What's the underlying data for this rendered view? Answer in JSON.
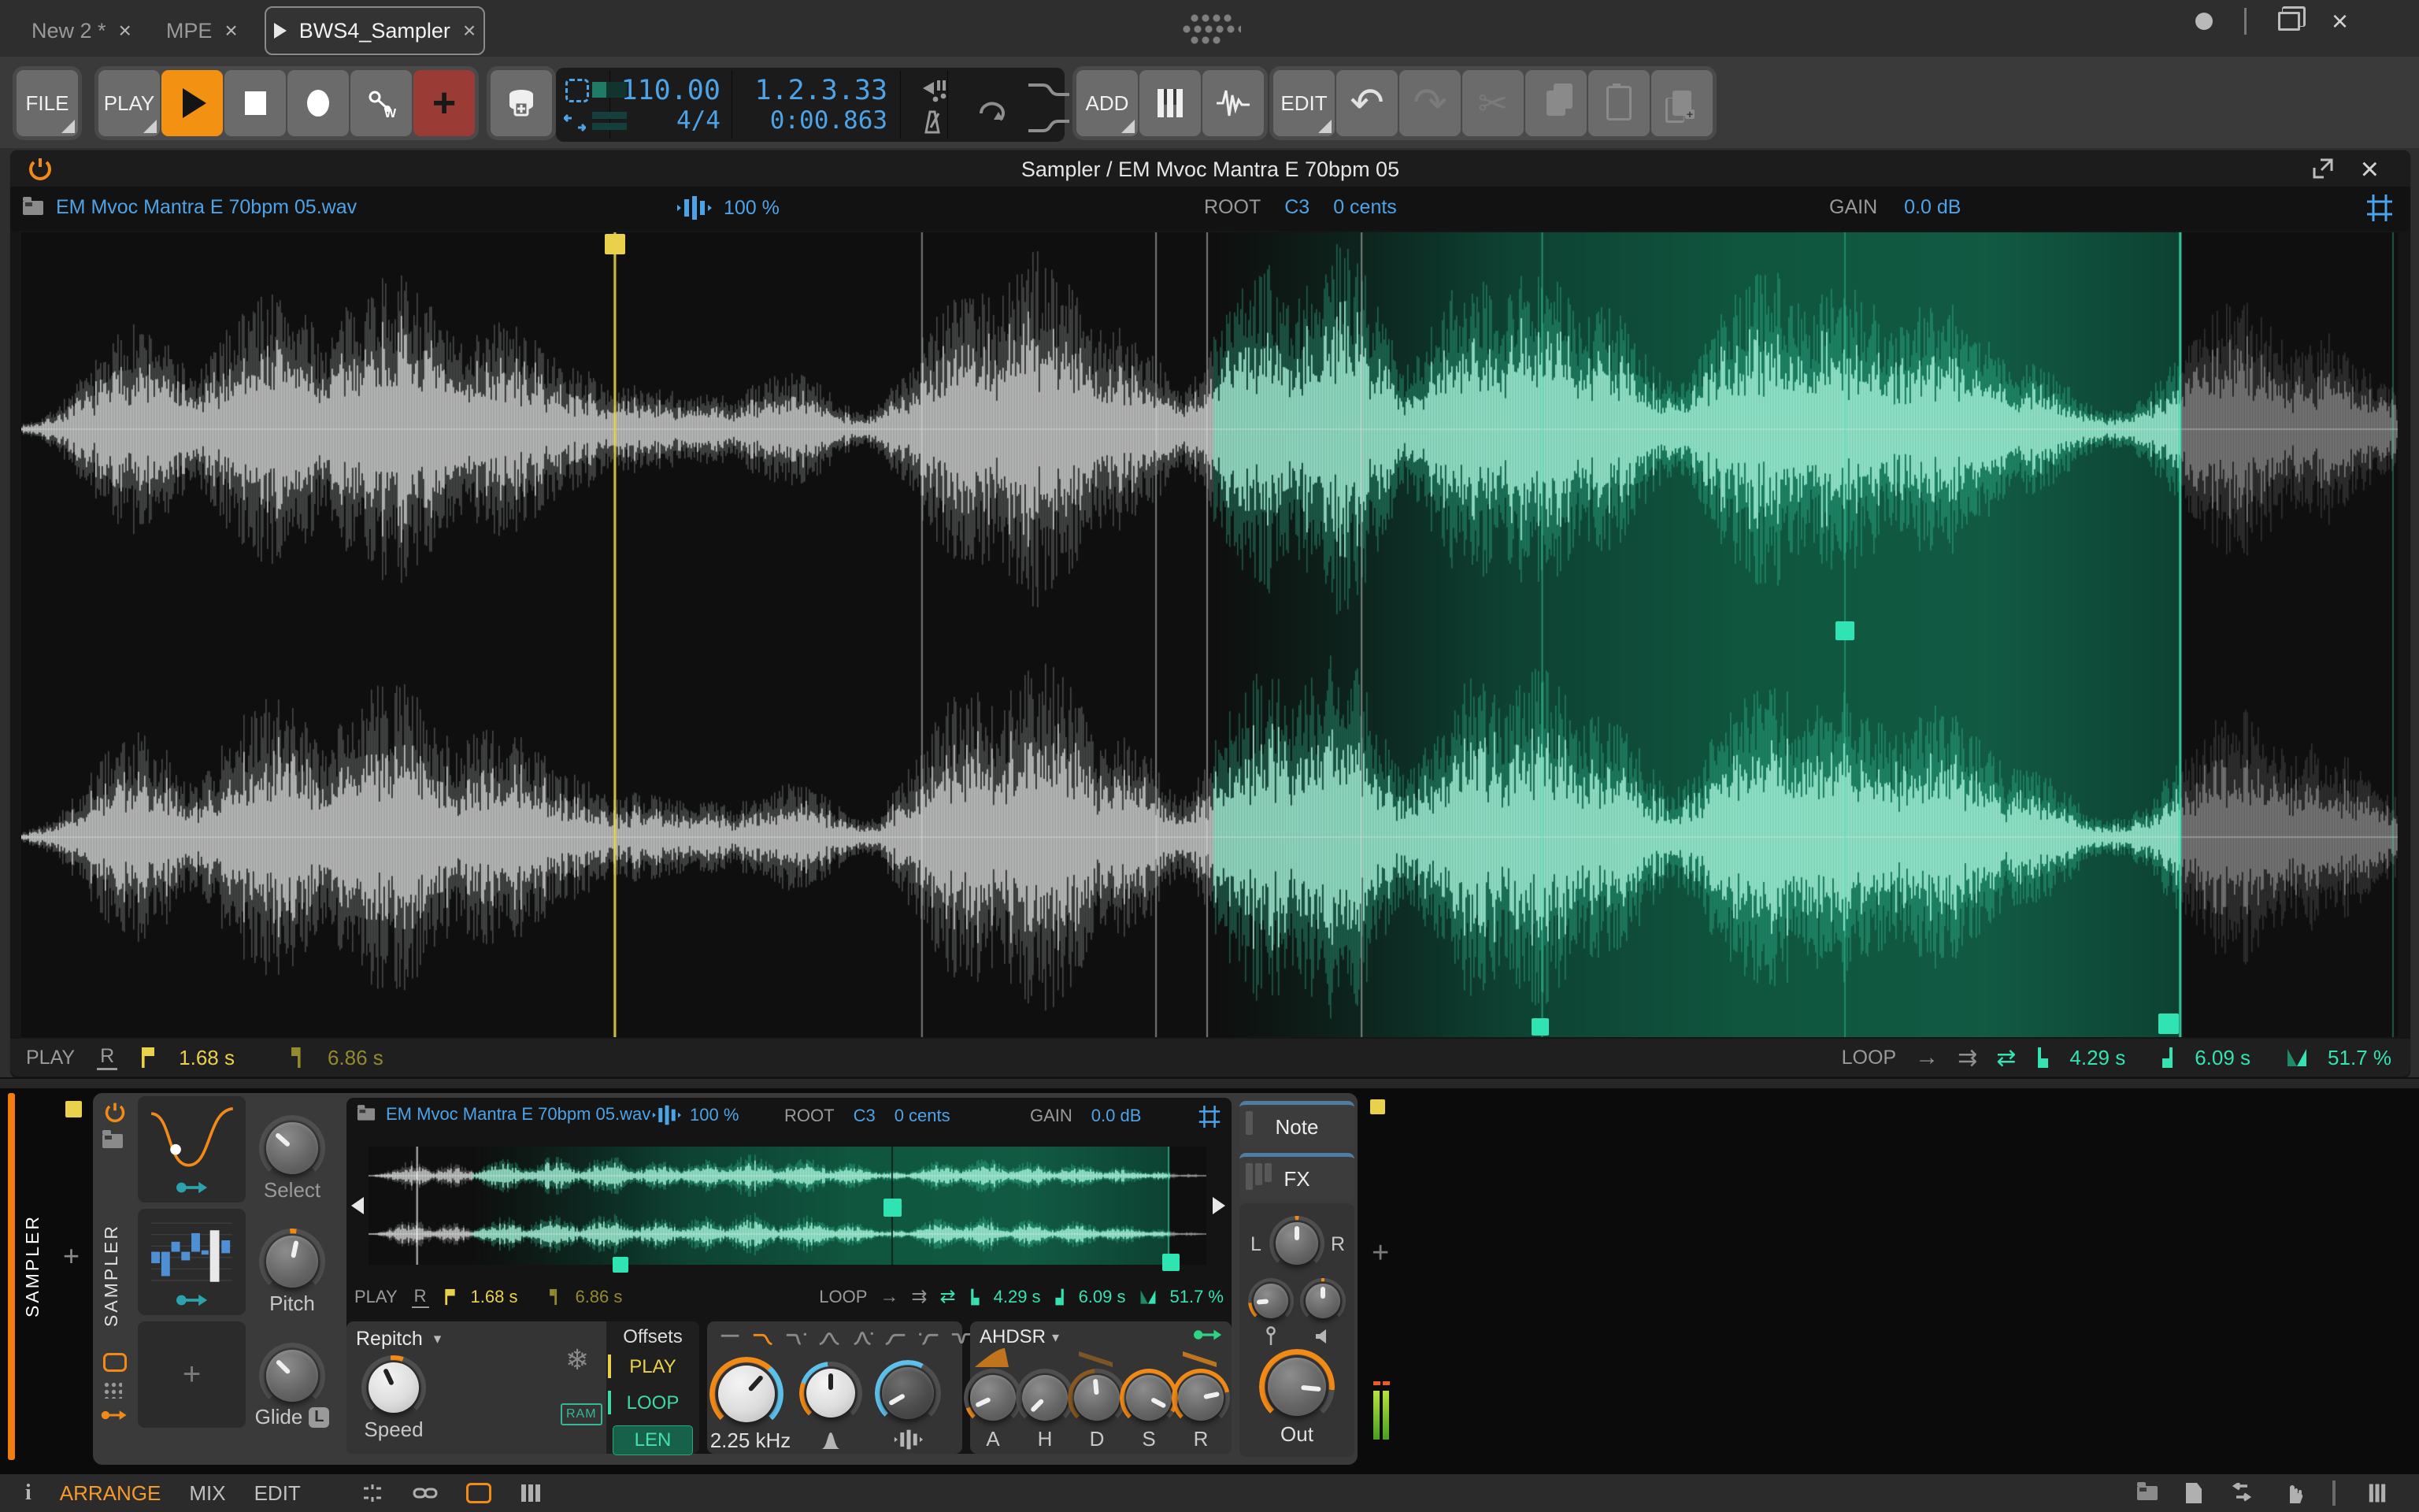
{
  "window": {
    "tabs": [
      {
        "label": "New 2 *"
      },
      {
        "label": "MPE"
      },
      {
        "label": "BWS4_Sampler"
      }
    ]
  },
  "toolbar": {
    "file_label": "FILE",
    "play_label": "PLAY",
    "add_label": "ADD",
    "edit_label": "EDIT",
    "tempo": "110.00",
    "time_signature": "4/4",
    "position_beats": "1.2.3.33",
    "position_time": "0:00.863"
  },
  "editor": {
    "title": "Sampler / EM Mvoc Mantra E 70bpm 05",
    "file_name": "EM Mvoc Mantra E 70bpm 05.wav",
    "stretch_amount": "100 %",
    "root_label": "ROOT",
    "root_note": "C3",
    "root_detune": "0 cents",
    "gain_label": "GAIN",
    "gain_value": "0.0 dB",
    "footer": {
      "play_label": "PLAY",
      "play_start": "1.68 s",
      "play_end": "6.86 s",
      "loop_label": "LOOP",
      "loop_start": "4.29 s",
      "loop_end": "6.09 s",
      "loop_crossfade": "51.7 %"
    }
  },
  "device": {
    "track_name": "SAMPLER",
    "device_name": "SAMPLER",
    "select_label": "Select",
    "pitch_label": "Pitch",
    "glide_label": "Glide",
    "glide_badge": "L",
    "display": {
      "file_name": "EM Mvoc Mantra E 70bpm 05.wav",
      "stretch_amount": "100 %",
      "root_label": "ROOT",
      "root_note": "C3",
      "root_detune": "0 cents",
      "gain_label": "GAIN",
      "gain_value": "0.0 dB",
      "play_label": "PLAY",
      "play_start": "1.68 s",
      "play_end": "6.86 s",
      "loop_label": "LOOP",
      "loop_start": "4.29 s",
      "loop_end": "6.09 s",
      "loop_crossfade": "51.7 %"
    },
    "mode": "Repitch",
    "speed_label": "Speed",
    "ram_label": "RAM",
    "offsets": {
      "title": "Offsets",
      "play": "PLAY",
      "loop": "LOOP",
      "len": "LEN"
    },
    "filter": {
      "cutoff": "2.25 kHz"
    },
    "envelope": {
      "title": "AHDSR",
      "attack": "A",
      "hold": "H",
      "decay": "D",
      "sustain": "S",
      "release": "R"
    },
    "output": {
      "out_label": "Out",
      "pan_left": "L",
      "pan_right": "R"
    },
    "chains": {
      "note": "Note",
      "fx": "FX"
    }
  },
  "bottom_bar": {
    "arrange": "ARRANGE",
    "mix": "MIX",
    "edit": "EDIT"
  },
  "glyphs": {
    "close": "×",
    "plus": "+",
    "tri": "",
    "reverse": "R",
    "ram": "RAM",
    "auto_w": "W",
    "info": "i",
    "snowflake": "❄",
    "arrow_once": "→",
    "arrow_fwd": "⇉",
    "arrow_pingpong": "⇄",
    "undo": "↶",
    "redo": "↷",
    "scissors": "✂",
    "left": "◀",
    "right": "▶",
    "dropdown": "▾"
  },
  "colors": {
    "accent_orange": "#f28a18",
    "accent_blue": "#4da3e8",
    "accent_teal": "#35e2b1",
    "accent_yellow": "#e9d14c",
    "record_red": "#9a3b35",
    "loop_green_bg": "#10563f"
  }
}
